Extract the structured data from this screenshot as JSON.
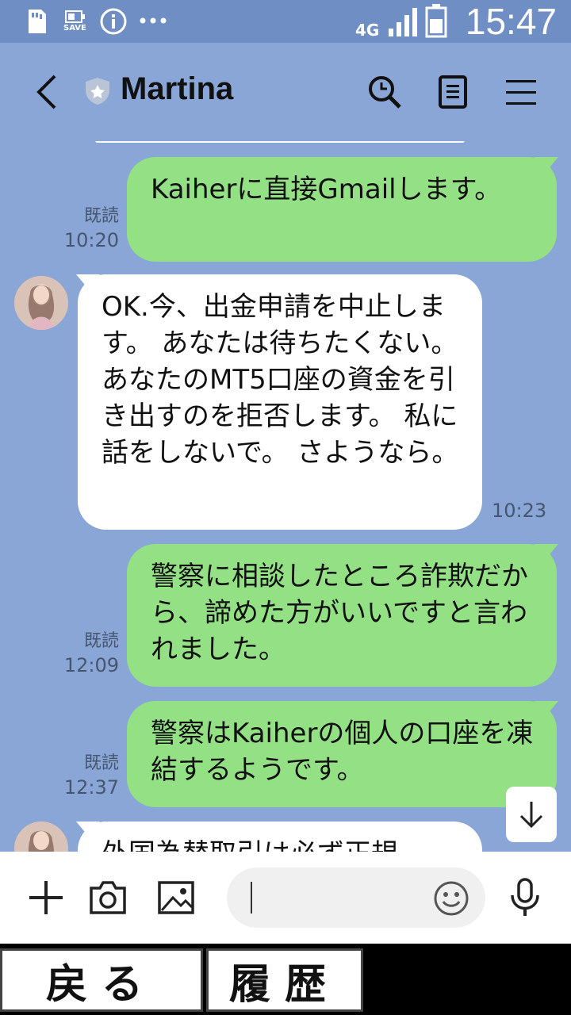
{
  "status_bar": {
    "time": "15:47",
    "network": "4G",
    "save_label": "SAVE",
    "icons": [
      "sd-card-icon",
      "battery-save-icon",
      "info-icon",
      "more-dots-icon",
      "signal-icon",
      "battery-icon"
    ]
  },
  "header": {
    "title": "Martina",
    "icons": [
      "back-icon",
      "shield-badge-icon",
      "search-icon",
      "notes-icon",
      "menu-icon"
    ]
  },
  "messages": [
    {
      "direction": "out",
      "text": "Kaiherに直接Gmailします。",
      "read": "既読",
      "time": "10:20"
    },
    {
      "direction": "in",
      "text": "OK.今、出金申請を中止します。 あなたは待ちたくない。 あなたのMT5口座の資金を引き出すのを拒否します。 私に話をしないで。 さようなら。",
      "time": "10:23"
    },
    {
      "direction": "out",
      "text": "警察に相談したところ詐欺だから、諦めた方がいいですと言われました。",
      "read": "既読",
      "time": "12:09"
    },
    {
      "direction": "out",
      "text": "警察はKaiherの個人の口座を凍結するようです。",
      "read": "既読",
      "time": "12:37"
    },
    {
      "direction": "in",
      "text": "外国為替取引は必ず正規",
      "time": ""
    }
  ],
  "input_bar": {
    "placeholder": "",
    "icons": [
      "plus-icon",
      "camera-icon",
      "image-icon",
      "emoji-icon",
      "microphone-icon"
    ]
  },
  "bottom_buttons": {
    "back": "戻る",
    "history": "履歴"
  },
  "colors": {
    "background": "#8aa6d6",
    "outgoing_bubble": "#93e085",
    "incoming_bubble": "#ffffff",
    "status_bar": "#6f8ec4"
  }
}
